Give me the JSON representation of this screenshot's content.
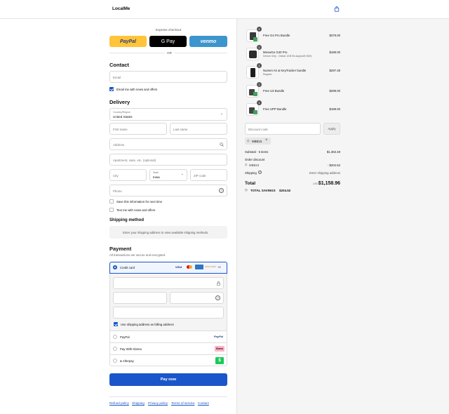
{
  "header": {
    "logo": "LocalMe",
    "cart_icon": "shopping-bag-icon"
  },
  "express": {
    "label": "Express checkout",
    "or": "OR",
    "paypal": "PayPal",
    "gpay": "G Pay",
    "venmo": "venmo"
  },
  "contact": {
    "title": "Contact",
    "email_placeholder": "Email",
    "email_news": "Email me with news and offers"
  },
  "delivery": {
    "title": "Delivery",
    "country_label": "Country/Region",
    "country_value": "United States",
    "first_name": "First name",
    "last_name": "Last name",
    "address": "Address",
    "apartment": "Apartment, suite, etc. (optional)",
    "city": "City",
    "state_label": "State",
    "state_value": "Iowa",
    "zip": "ZIP code",
    "phone": "Phone",
    "save_info": "Save this information for next time",
    "text_news": "Text me with news and offers"
  },
  "shipping": {
    "title": "Shipping method",
    "placeholder": "Enter your shipping address to view available shipping methods."
  },
  "payment": {
    "title": "Payment",
    "subtitle": "All transactions are secure and encrypted.",
    "credit_card": "Credit card",
    "card_more": "+2",
    "billing_same": "Use shipping address as billing address",
    "paypal": "PayPal",
    "paypal_logo": "PayPal",
    "klarna": "Pay With Klarna",
    "klarna_logo": "Klarna",
    "afterpay": "& Afterpay",
    "afterpay_logo": "$",
    "pay_now": "Pay now"
  },
  "footer": {
    "links": [
      "Refund policy",
      "Shipping",
      "Privacy policy",
      "Terms of service",
      "Contact"
    ]
  },
  "summary": {
    "items": [
      {
        "qty": "1",
        "name": "Free G4 Pro Bundle",
        "sub": "",
        "price": "$379.00"
      },
      {
        "qty": "1",
        "name": "MeowGo G40 Pro",
        "sub": "Device Only - Global 1GB 90-day(worth $29)",
        "price": "$189.00"
      },
      {
        "qty": "1",
        "name": "Numen Air & KeyTracker bundle",
        "sub": "Regular",
        "price": "$297.48"
      },
      {
        "qty": "1",
        "name": "Free U3 Bundle",
        "sub": "",
        "price": "$299.00"
      },
      {
        "qty": "1",
        "name": "Free UPP Bundle",
        "sub": "",
        "price": "$199.00"
      }
    ],
    "discount_placeholder": "Discount code",
    "apply": "Apply",
    "code_tag": "MBB15",
    "subtotal_label": "Subtotal · 5 items",
    "subtotal_value": "$1,363.48",
    "order_discount": "Order discount",
    "discount_code": "MBB15",
    "discount_value": "- $204.52",
    "shipping_label": "Shipping",
    "shipping_value": "Enter shipping address",
    "total_label": "Total",
    "currency": "USD",
    "total_value": "$1,158.96",
    "savings_label": "TOTAL SAVINGS",
    "savings_value": "$204.52"
  },
  "colors": {
    "accent": "#1a56c9",
    "paypal": "#ffc439",
    "venmo": "#3d95ce",
    "afterpay": "#b2fce4"
  }
}
